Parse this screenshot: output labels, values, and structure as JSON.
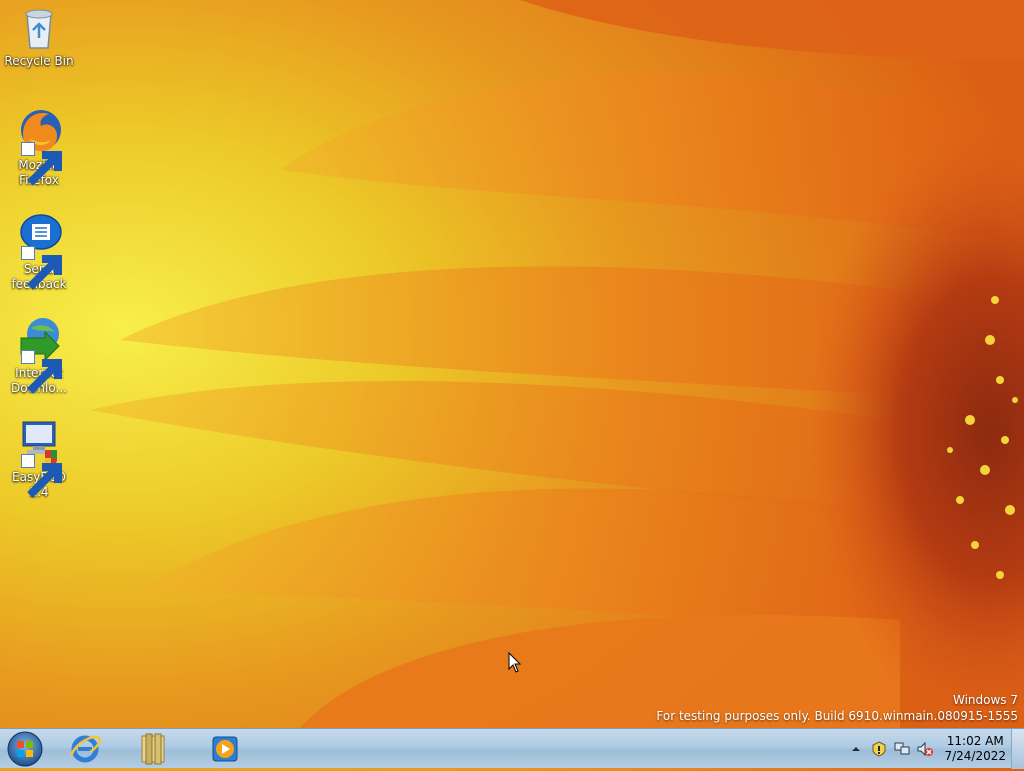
{
  "desktop": {
    "icons": [
      {
        "label": "Recycle Bin",
        "icon": "recycle-bin-icon"
      },
      {
        "label": "Mozilla Firefox",
        "icon": "firefox-icon"
      },
      {
        "label": "Send feedback",
        "icon": "feedback-icon"
      },
      {
        "label": "Internet Downlo...",
        "icon": "internet-download-manager-icon"
      },
      {
        "label": "EasyBCD 2.4",
        "icon": "easybcd-icon"
      }
    ],
    "watermark": {
      "line1": "Windows  7",
      "line2": "For testing purposes only. Build 6910.winmain.080915-1555"
    }
  },
  "taskbar": {
    "pinned": [
      "start-orb-icon",
      "internet-explorer-icon",
      "file-explorer-icon",
      "media-player-icon"
    ],
    "tray": [
      "show-hidden-icons-icon",
      "action-center-icon",
      "network-icon",
      "volume-muted-icon"
    ],
    "clock": {
      "time": "11:02 AM",
      "date": "7/24/2022"
    }
  },
  "colors": {
    "taskbar": "#aecbe4",
    "wallpaper_orange": "#e06a17",
    "wallpaper_yellow": "#f7ea3f"
  }
}
